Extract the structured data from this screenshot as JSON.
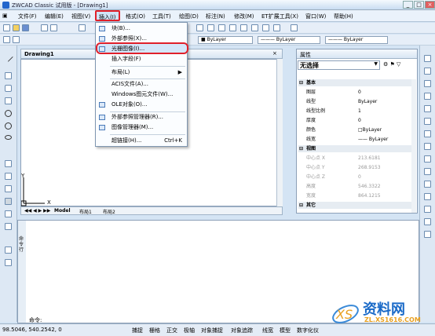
{
  "window": {
    "title": "ZWCAD Classic 试用版 - [Drawing1]"
  },
  "menubar": [
    "文件(F)",
    "编辑(E)",
    "视图(V)",
    "插入(I)",
    "格式(O)",
    "工具(T)",
    "绘图(D)",
    "标注(N)",
    "修改(M)",
    "ET扩展工具(X)",
    "窗口(W)",
    "帮助(H)"
  ],
  "toolbar": {
    "layer_current": "0",
    "color": "ByLayer",
    "linetype": "ByLayer",
    "lineweight": "ByLayer"
  },
  "insert_menu": [
    {
      "label": "块(B)...",
      "shortcut": ""
    },
    {
      "label": "外部参照(X)...",
      "shortcut": ""
    },
    {
      "label": "光栅图像(I)...",
      "shortcut": ""
    },
    {
      "label": "插入字段(F)",
      "shortcut": ""
    },
    {
      "label": "布局(L)",
      "shortcut": "▶"
    },
    {
      "label": "ACIS文件(A)...",
      "shortcut": ""
    },
    {
      "label": "Windows图元文件(W)...",
      "shortcut": ""
    },
    {
      "label": "OLE对象(O)...",
      "shortcut": ""
    },
    {
      "label": "外部参照管理器(R)...",
      "shortcut": ""
    },
    {
      "label": "图像管理器(M)...",
      "shortcut": ""
    },
    {
      "label": "超链接(H)...",
      "shortcut": "Ctrl+K"
    }
  ],
  "drawing": {
    "tab": "Drawing1",
    "axis_x": "X",
    "axis_y": "Y"
  },
  "layout_tabs": [
    "Model",
    "布局1",
    "布局2"
  ],
  "properties": {
    "title": "属性",
    "selection": "无选择",
    "rows": [
      {
        "k": "基本",
        "v": "",
        "header": true
      },
      {
        "k": "图层",
        "v": "0"
      },
      {
        "k": "线型",
        "v": "ByLayer"
      },
      {
        "k": "线型比例",
        "v": "1"
      },
      {
        "k": "厚度",
        "v": "0"
      },
      {
        "k": "颜色",
        "v": "□ByLayer"
      },
      {
        "k": "线宽",
        "v": "—— ByLayer"
      },
      {
        "k": "视图",
        "v": "",
        "header": true
      },
      {
        "k": "中心点 X",
        "v": "213.6181",
        "grey": true
      },
      {
        "k": "中心点 Y",
        "v": "268.9153",
        "grey": true
      },
      {
        "k": "中心点 Z",
        "v": "0",
        "grey": true
      },
      {
        "k": "高度",
        "v": "546.3322",
        "grey": true
      },
      {
        "k": "宽度",
        "v": "864.1215",
        "grey": true
      },
      {
        "k": "其它",
        "v": "",
        "header": true
      }
    ]
  },
  "command": {
    "label": "命令:",
    "side_label": "命令行"
  },
  "status": {
    "coords": "98.5046, 540.2542, 0",
    "toggles": [
      "捕捉",
      "栅格",
      "正交",
      "极轴",
      "对象捕捉",
      "对象追踪",
      "线宽",
      "模型",
      "数字化仪"
    ]
  },
  "watermark": {
    "text": "资料网",
    "url": "ZL.XS1616.COM"
  }
}
